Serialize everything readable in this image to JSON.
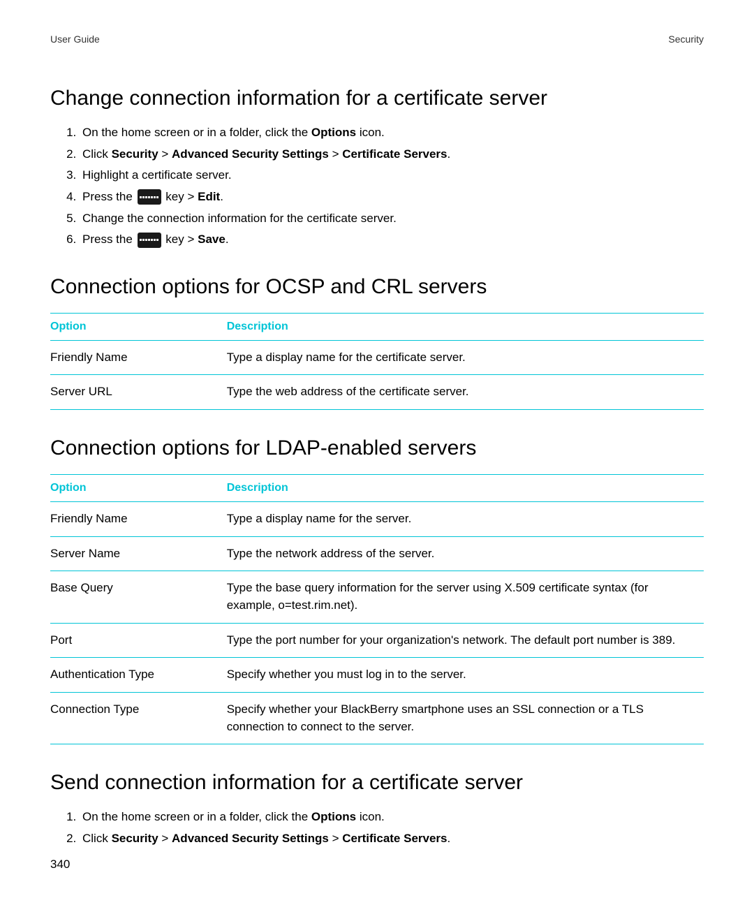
{
  "header": {
    "left": "User Guide",
    "right": "Security"
  },
  "page_number": "340",
  "sections": {
    "change": {
      "title": "Change connection information for a certificate server",
      "step1_a": "On the home screen or in a folder, click the ",
      "step1_b": "Options",
      "step1_c": " icon.",
      "step2_a": "Click ",
      "step2_b": "Security",
      "step2_c": " > ",
      "step2_d": "Advanced Security Settings",
      "step2_e": " > ",
      "step2_f": "Certificate Servers",
      "step2_g": ".",
      "step3": "Highlight a certificate server.",
      "step4_a": "Press the ",
      "step4_b": " key > ",
      "step4_c": "Edit",
      "step4_d": ".",
      "step5": "Change the connection information for the certificate server.",
      "step6_a": "Press the ",
      "step6_b": " key > ",
      "step6_c": "Save",
      "step6_d": "."
    },
    "ocsp": {
      "title": "Connection options for OCSP and CRL servers",
      "headers": {
        "option": "Option",
        "description": "Description"
      },
      "rows": [
        {
          "option": "Friendly Name",
          "description": "Type a display name for the certificate server."
        },
        {
          "option": "Server URL",
          "description": "Type the web address of the certificate server."
        }
      ]
    },
    "ldap": {
      "title": "Connection options for LDAP-enabled servers",
      "headers": {
        "option": "Option",
        "description": "Description"
      },
      "rows": [
        {
          "option": "Friendly Name",
          "description": "Type a display name for the server."
        },
        {
          "option": "Server Name",
          "description": "Type the network address of the server."
        },
        {
          "option": "Base Query",
          "description": "Type the base query information for the server using X.509 certificate syntax (for example, o=test.rim.net)."
        },
        {
          "option": "Port",
          "description": "Type the port number for your organization's network. The default port number is 389."
        },
        {
          "option": "Authentication Type",
          "description": "Specify whether you must log in to the server."
        },
        {
          "option": "Connection Type",
          "description": "Specify whether your BlackBerry smartphone uses an SSL connection or a TLS connection to connect to the server."
        }
      ]
    },
    "send": {
      "title": "Send connection information for a certificate server",
      "step1_a": "On the home screen or in a folder, click the ",
      "step1_b": "Options",
      "step1_c": " icon.",
      "step2_a": "Click ",
      "step2_b": "Security",
      "step2_c": " > ",
      "step2_d": "Advanced Security Settings",
      "step2_e": " > ",
      "step2_f": "Certificate Servers",
      "step2_g": "."
    }
  }
}
